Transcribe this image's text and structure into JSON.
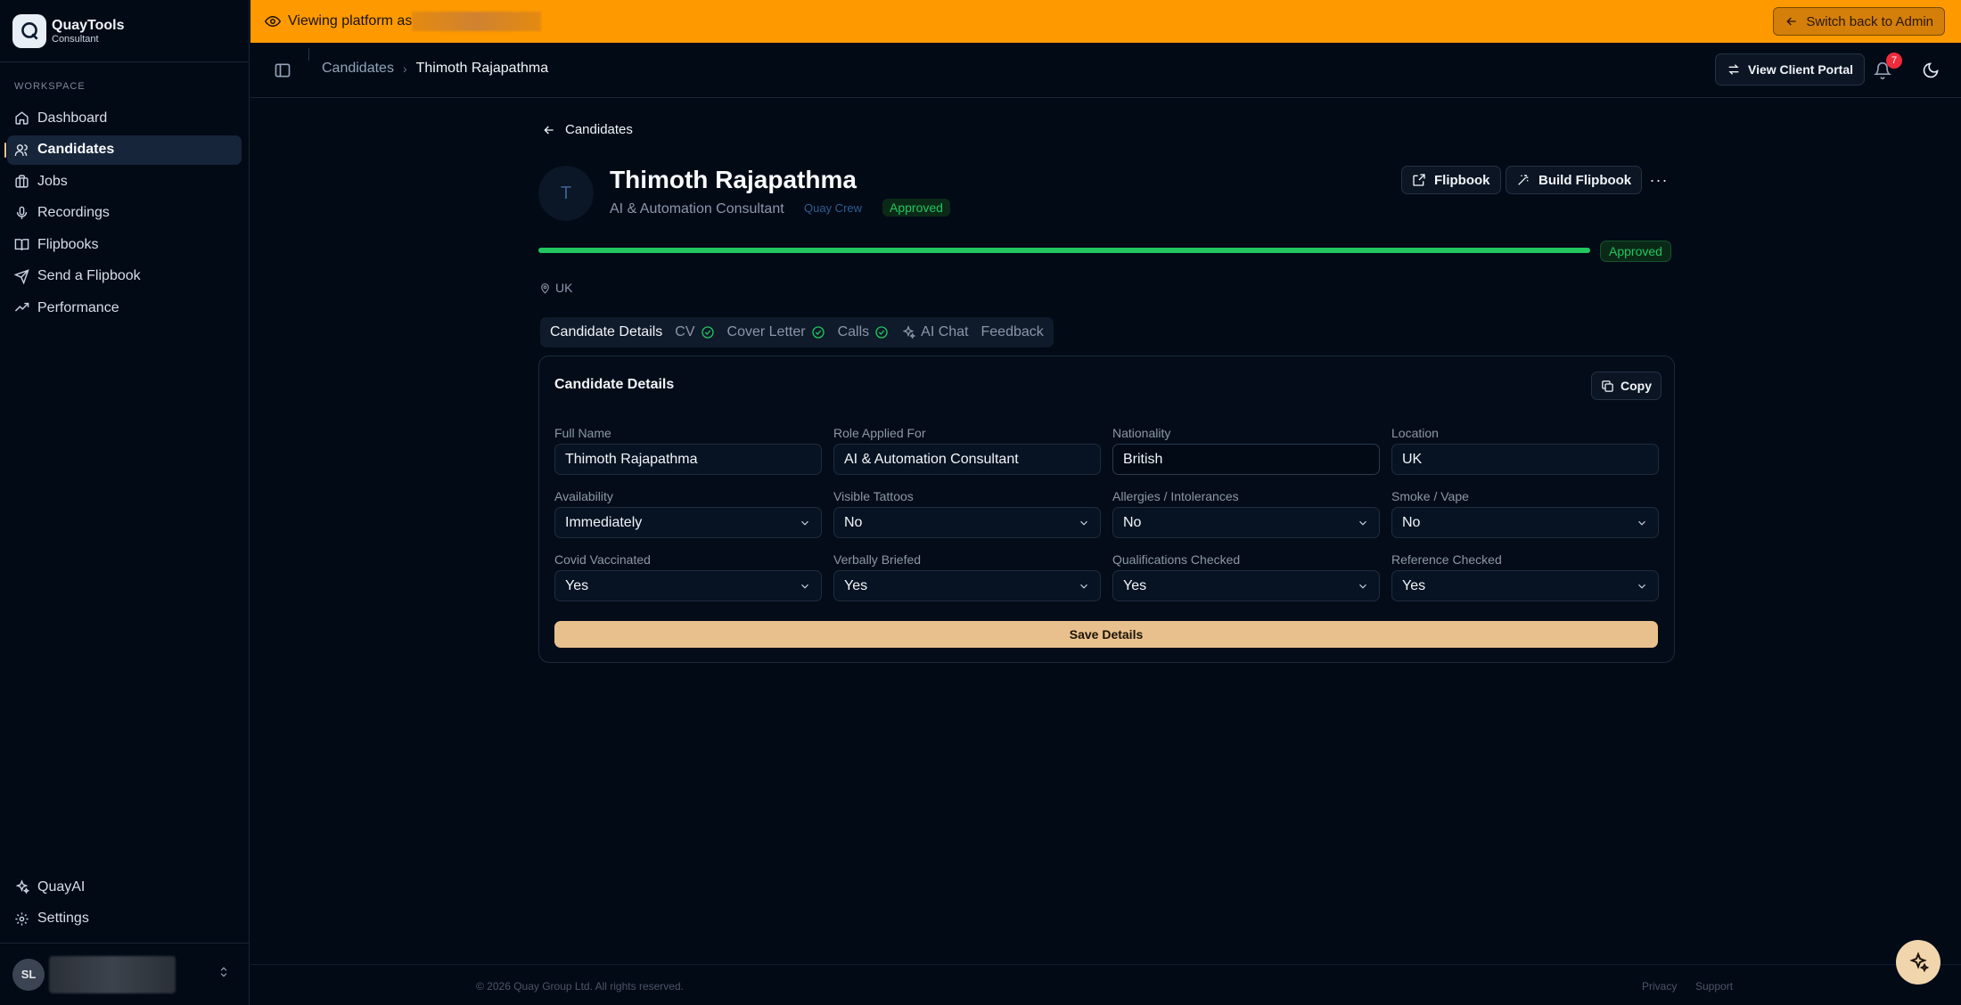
{
  "brand": {
    "name": "QuayTools",
    "subtitle": "Consultant"
  },
  "sidebar": {
    "section_label": "WORKSPACE",
    "items": [
      {
        "label": "Dashboard",
        "icon": "home-icon",
        "active": false
      },
      {
        "label": "Candidates",
        "icon": "users-icon",
        "active": true
      },
      {
        "label": "Jobs",
        "icon": "briefcase-icon",
        "active": false
      },
      {
        "label": "Recordings",
        "icon": "microphone-icon",
        "active": false
      },
      {
        "label": "Flipbooks",
        "icon": "book-open-icon",
        "active": false
      },
      {
        "label": "Send a Flipbook",
        "icon": "send-icon",
        "active": false
      },
      {
        "label": "Performance",
        "icon": "trending-up-icon",
        "active": false
      }
    ],
    "bottom_items": [
      {
        "label": "QuayAI",
        "icon": "sparkles-icon"
      },
      {
        "label": "Settings",
        "icon": "gear-icon"
      }
    ],
    "user_initials": "SL"
  },
  "banner": {
    "text": "Viewing platform as",
    "switch_label": "Switch back to Admin"
  },
  "topbar": {
    "breadcrumb": [
      "Candidates",
      "Thimoth Rajapathma"
    ],
    "client_portal_label": "View Client Portal",
    "notification_count": "7"
  },
  "candidate": {
    "back_label": "Candidates",
    "initial": "T",
    "name": "Thimoth Rajapathma",
    "role": "AI & Automation Consultant",
    "team_tag": "Quay Crew",
    "status_tag": "Approved",
    "progress_fraction": 1.0,
    "progress_label": "Approved",
    "location": "UK",
    "flipbook_label": "Flipbook",
    "build_flipbook_label": "Build Flipbook",
    "more_label": "···"
  },
  "tabs": [
    {
      "label": "Candidate Details",
      "active": true,
      "check": false
    },
    {
      "label": "CV",
      "active": false,
      "check": true
    },
    {
      "label": "Cover Letter",
      "active": false,
      "check": true
    },
    {
      "label": "Calls",
      "active": false,
      "check": true
    },
    {
      "label": "AI Chat",
      "active": false,
      "check": false
    },
    {
      "label": "Feedback",
      "active": false,
      "check": false
    }
  ],
  "details": {
    "title": "Candidate Details",
    "copy_label": "Copy",
    "fields": [
      {
        "label": "Full Name",
        "value": "Thimoth Rajapathma",
        "type": "input"
      },
      {
        "label": "Role Applied For",
        "value": "AI & Automation Consultant",
        "type": "input"
      },
      {
        "label": "Nationality",
        "value": "British",
        "type": "input"
      },
      {
        "label": "Location",
        "value": "UK",
        "type": "input"
      },
      {
        "label": "Availability",
        "value": "Immediately",
        "type": "select"
      },
      {
        "label": "Visible Tattoos",
        "value": "No",
        "type": "select"
      },
      {
        "label": "Allergies / Intolerances",
        "value": "No",
        "type": "select"
      },
      {
        "label": "Smoke / Vape",
        "value": "No",
        "type": "select"
      },
      {
        "label": "Covid Vaccinated",
        "value": "Yes",
        "type": "select"
      },
      {
        "label": "Verbally Briefed",
        "value": "Yes",
        "type": "select"
      },
      {
        "label": "Qualifications Checked",
        "value": "Yes",
        "type": "select"
      },
      {
        "label": "Reference Checked",
        "value": "Yes",
        "type": "select"
      }
    ],
    "save_label": "Save Details"
  },
  "footer": {
    "copyright": "© 2026 Quay Group Ltd. All rights reserved.",
    "privacy": "Privacy",
    "support": "Support"
  },
  "colors": {
    "banner": "#fe9a00",
    "accent": "#e8c08d",
    "success": "#22c55e",
    "background": "#020a16"
  }
}
